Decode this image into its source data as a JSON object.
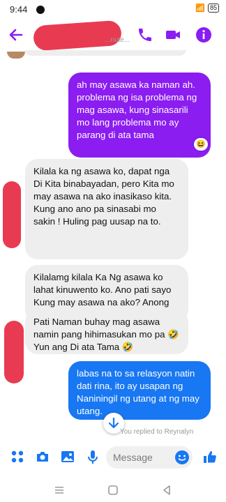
{
  "status_bar": {
    "time": "9:44",
    "battery": "85"
  },
  "header": {
    "subtitle": "...nute..."
  },
  "messages": [
    {
      "id": "m1",
      "side": "out",
      "color": "purple",
      "text": "ah may asawa ka naman ah. problema ng isa problema ng mag asawa, kung sinasarili mo lang problema mo ay parang di ata tama",
      "reaction": "😆"
    },
    {
      "id": "m2",
      "side": "in",
      "text": "Kilala ka ng asawa ko, dapat nga Di Kita binabayadan, pero Kita mo may asawa na ako inasikaso kita. Kung ano ano pa sinasabi mo sakin ! Huling pag uusap na to."
    },
    {
      "id": "m3",
      "side": "in",
      "text": "Kilalamg kilala Ka Ng asawa ko lahat kinuwento ko. Ano pati sayo Kung may asawa na ako? Anong connect?"
    },
    {
      "id": "m4",
      "side": "in",
      "text": "Pati Naman buhay mag asawa namin pang hihimasukan mo pa 🤣 Yun ang Di ata Tama 🤣"
    },
    {
      "id": "m5",
      "side": "out",
      "color": "blue",
      "text": "labas na to sa relasyon natin dati rina, ito ay usapan ng Naniningil ng utang at ng may utang."
    }
  ],
  "reply_note": "You replied to Reynalyn",
  "composer": {
    "placeholder": "Message"
  },
  "colors": {
    "accent": "#8b1df0",
    "blue": "#1877f2",
    "redaction": "#e83b52"
  },
  "icons": {
    "header": [
      "back-arrow-icon",
      "phone-icon",
      "video-icon",
      "info-icon"
    ],
    "composer": [
      "grid-icon",
      "camera-icon",
      "gallery-icon",
      "mic-icon",
      "emoji-icon",
      "like-icon"
    ],
    "nav": [
      "menu-icon",
      "home-icon",
      "back-icon"
    ]
  }
}
